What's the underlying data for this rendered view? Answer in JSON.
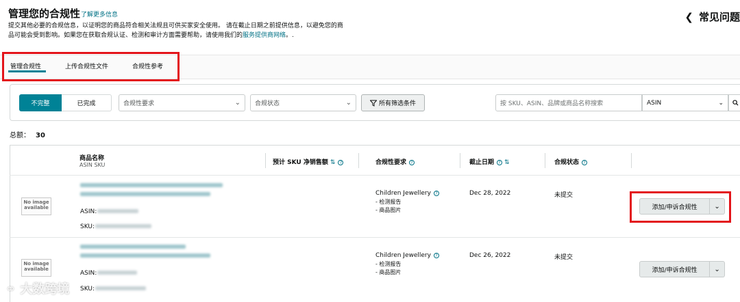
{
  "header": {
    "title": "管理您的合规性",
    "learn_more": "了解更多信息",
    "desc_line1": "提交其他必要的合规信息，以证明您的商品符合相关法规且可供买家安全使用。 请在截止日期之前提供信息，以避免您的商",
    "desc_line2_prefix": "品可能会受到影响。如果您在获取合规认证、检测和审计方面需要帮助，请使用我们的",
    "desc_line2_link": "服务提供商网络",
    "desc_line2_suffix": "。.",
    "faq": "常见问题"
  },
  "tabs": [
    {
      "label": "管理合规性",
      "active": true
    },
    {
      "label": "上传合规性文件",
      "active": false
    },
    {
      "label": "合规性参考",
      "active": false
    }
  ],
  "filters": {
    "segment_incomplete": "不完整",
    "segment_complete": "已完成",
    "requirement_placeholder": "合规性要求",
    "status_placeholder": "合规状态",
    "all_filters": "所有筛选条件",
    "search_placeholder": "按 SKU、ASIN、品牌或商品名称搜索",
    "search_type": "ASIN"
  },
  "total": {
    "label": "总额：",
    "value": "30"
  },
  "table": {
    "headers": {
      "product_name": "商品名称",
      "product_sub": "ASIN  SKU",
      "sales": "预计 SKU 净销售额",
      "requirement": "合规性要求",
      "deadline": "截止日期",
      "status": "合规状态"
    },
    "rows": [
      {
        "no_image_1": "No image",
        "no_image_2": "available",
        "asin_label": "ASIN:",
        "sku_label": "SKU:",
        "requirement": "Children Jewellery",
        "req_item_1": "- 检测报告",
        "req_item_2": "- 商品图片",
        "deadline": "Dec 28, 2022",
        "status": "未提交",
        "action": "添加/申诉合规性"
      },
      {
        "no_image_1": "No image",
        "no_image_2": "available",
        "asin_label": "ASIN:",
        "sku_label": "SKU:",
        "requirement": "Children Jewellery",
        "req_item_1": "- 检测报告",
        "req_item_2": "- 商品图片",
        "deadline": "Dec 26, 2022",
        "status": "未提交",
        "action": "添加/申诉合规性"
      }
    ]
  },
  "watermark": "大数跨境",
  "colors": {
    "accent": "#008296",
    "link": "#007185",
    "highlight": "#e3141a"
  }
}
